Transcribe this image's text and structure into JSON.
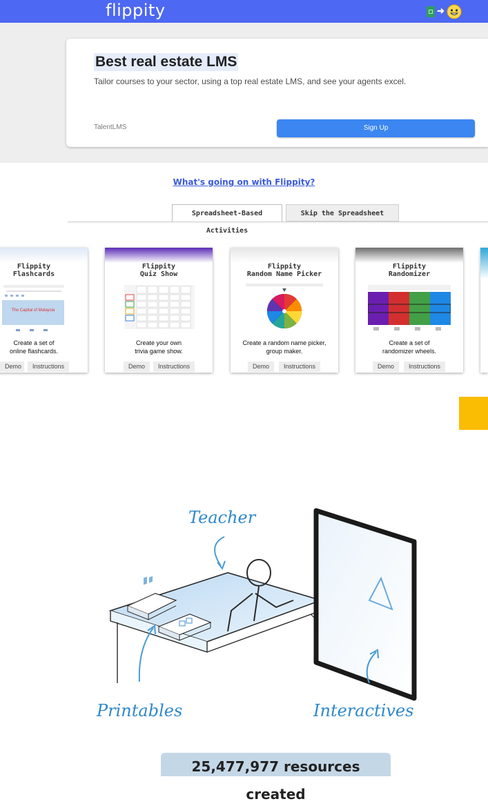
{
  "header": {
    "logo_text": "flippity",
    "brand_color": "#4d68f2",
    "icons": [
      "spreadsheet-icon",
      "arrow-right-icon",
      "smiley-icon"
    ]
  },
  "ad": {
    "title": "Best real estate LMS",
    "description": "Tailor courses to your sector, using a top real estate LMS, and see your agents excel.",
    "advertiser": "TalentLMS",
    "cta_label": "Sign Up",
    "cta_color": "#3b86f0"
  },
  "news_link": "What's going on with Flippity?",
  "tabs": [
    {
      "label": "Spreadsheet-Based Activities",
      "active": true
    },
    {
      "label": "Skip the Spreadsheet",
      "active": false
    }
  ],
  "activities": [
    {
      "title_line1": "Flippity",
      "title_line2": "Flashcards",
      "desc_line1": "Create a set of",
      "desc_line2": "online flashcards.",
      "preview_card_text": "The Capital of Malaysia",
      "demo_label": "Demo",
      "instructions_label": "Instructions"
    },
    {
      "title_line1": "Flippity",
      "title_line2": "Quiz Show",
      "desc_line1": "Create your own",
      "desc_line2": "trivia game show.",
      "demo_label": "Demo",
      "instructions_label": "Instructions"
    },
    {
      "title_line1": "Flippity",
      "title_line2": "Random Name Picker",
      "desc_line1": "Create a random name picker,",
      "desc_line2": "group maker.",
      "demo_label": "Demo",
      "instructions_label": "Instructions"
    },
    {
      "title_line1": "Flippity",
      "title_line2": "Randomizer",
      "desc_line1": "Create a set of",
      "desc_line2": "randomizer wheels.",
      "demo_label": "Demo",
      "instructions_label": "Instructions"
    }
  ],
  "illustration": {
    "label_teacher": "Teacher",
    "label_printables": "Printables",
    "label_interactives": "Interactives"
  },
  "counter_text": "25,477,977 resources created"
}
